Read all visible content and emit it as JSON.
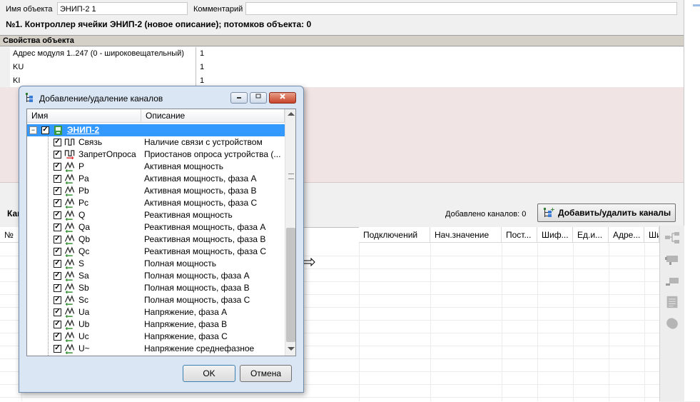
{
  "header": {
    "object_name_label": "Имя объекта",
    "object_name_value": "ЭНИП-2 1",
    "comment_label": "Комментарий",
    "comment_value": "",
    "description": "№1. Контроллер ячейки ЭНИП-2 (новое описание); потомков объекта: 0"
  },
  "properties": {
    "title": "Свойства объекта",
    "rows": [
      {
        "name": "Адрес модуля 1..247 (0 - широковещательный)",
        "value": "1"
      },
      {
        "name": "KU",
        "value": "1"
      },
      {
        "name": "KI",
        "value": "1"
      }
    ]
  },
  "channels_bar": {
    "tab_label_partial": "Кан",
    "added_count": "Добавлено каналов: 0",
    "add_button": "Добавить/удалить каналы"
  },
  "grid": {
    "columns": [
      "№",
      "Подключений",
      "Нач.значение",
      "Пост...",
      "Шиф...",
      "Ед.и...",
      "Адре...",
      "Ши"
    ]
  },
  "dialog": {
    "title": "Добавление/удаление каналов",
    "col_name": "Имя",
    "col_desc": "Описание",
    "root": {
      "name": "ЭНИП-2",
      "checked": true,
      "expander": "−"
    },
    "items": [
      {
        "name": "Связь",
        "desc": "Наличие связи с устройством",
        "icon": "pulse-icon",
        "checked": true
      },
      {
        "name": "ЗапретОпроса",
        "desc": "Приостанов опроса устройства (...",
        "icon": "pulse-out-icon",
        "checked": true
      },
      {
        "name": "P",
        "desc": "Активная мощность",
        "icon": "analog-icon",
        "checked": true
      },
      {
        "name": "Pa",
        "desc": "Активная мощность, фаза А",
        "icon": "analog-icon",
        "checked": true
      },
      {
        "name": "Pb",
        "desc": "Активная мощность, фаза В",
        "icon": "analog-icon",
        "checked": true
      },
      {
        "name": "Pc",
        "desc": "Активная мощность, фаза С",
        "icon": "analog-icon",
        "checked": true
      },
      {
        "name": "Q",
        "desc": "Реактивная мощность",
        "icon": "analog-icon",
        "checked": true
      },
      {
        "name": "Qa",
        "desc": "Реактивная мощность, фаза А",
        "icon": "analog-icon",
        "checked": true
      },
      {
        "name": "Qb",
        "desc": "Реактивная мощность, фаза В",
        "icon": "analog-icon",
        "checked": true
      },
      {
        "name": "Qc",
        "desc": "Реактивная мощность, фаза С",
        "icon": "analog-icon",
        "checked": true
      },
      {
        "name": "S",
        "desc": "Полная мощность",
        "icon": "analog-icon",
        "checked": true
      },
      {
        "name": "Sa",
        "desc": "Полная мощность, фаза А",
        "icon": "analog-icon",
        "checked": true
      },
      {
        "name": "Sb",
        "desc": "Полная мощность, фаза В",
        "icon": "analog-icon",
        "checked": true
      },
      {
        "name": "Sc",
        "desc": "Полная мощность, фаза С",
        "icon": "analog-icon",
        "checked": true
      },
      {
        "name": "Ua",
        "desc": "Напряжение, фаза А",
        "icon": "analog-icon",
        "checked": true
      },
      {
        "name": "Ub",
        "desc": "Напряжение, фаза В",
        "icon": "analog-icon",
        "checked": true
      },
      {
        "name": "Uc",
        "desc": "Напряжение, фаза С",
        "icon": "analog-icon",
        "checked": true
      },
      {
        "name": "U~",
        "desc": "Напряжение среднефазное",
        "icon": "analog-icon",
        "checked": true
      }
    ],
    "ok_label": "OK",
    "cancel_label": "Отмена"
  },
  "colors": {
    "selection": "#3399ff",
    "pink_panel": "#f1e4e4",
    "dialog_frame": "#dbe6f4"
  }
}
